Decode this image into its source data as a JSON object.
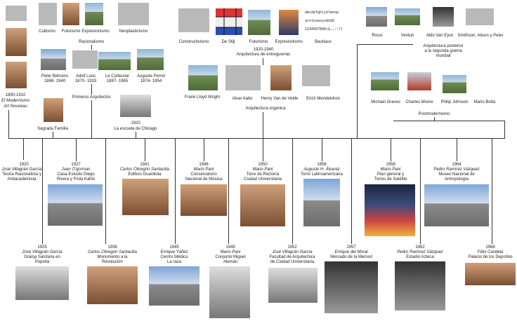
{
  "top_styles": {
    "cubismo": "Cubismo",
    "futurismo": "Futurismo",
    "expresionismo": "Expresionismo",
    "neoplasticismo": "Neoplasticismo",
    "racionalismo": "Racionalismo",
    "modernismo_years": "1890-1910",
    "modernismo_1": "El Modernismo",
    "modernismo_2": "Art Nouveau"
  },
  "architects_row1": {
    "behrens": "Peter Behrens",
    "behrens_years": "1868- 1940",
    "loos": "Adolf Loos",
    "loos_years": "1870- 1933",
    "corbusier": "Le Corbusier",
    "corbusier_years": "1887- 1965",
    "perret": "Auguste Perret",
    "perret_years": "1874- 1954"
  },
  "primeros": {
    "label": "Primeros Arquitectos",
    "sagrada": "Sagrada Familia",
    "chicago_year": "1920",
    "chicago": "La escuela de Chicago"
  },
  "entreguerras": {
    "constructivismo": "Constructivismo",
    "destijl": "De Stijl",
    "futurismo": "Futurismo",
    "expresionismo": "Expresionismo",
    "bauhaus": "Bauhaus",
    "years": "1920-1940",
    "label": "Arquitectura de entreguerras",
    "wright": "Frank Lloyd Wright",
    "aalto": "Alvar Aalto",
    "velde": "Henry Van de Velde",
    "mendelshon": "Erich Mendelshon",
    "organica": "Arquitectura organica",
    "bauhaus_font_1": "abcdefghijklmnop",
    "bauhaus_font_2": "qrstuvwxyzäöüß",
    "bauhaus_font_3": "1234567890(&.,:!?)"
  },
  "posterior": {
    "rossi": "Rossi",
    "venturi": "Venturi",
    "eyck": "Aldo Van Eyck",
    "smithson": "Smithson, Alison y Peter",
    "label_1": "Arquitectura posterior",
    "label_2": "a la segunda guerra",
    "label_3": "mundial",
    "graves": "Michael Graves",
    "moore": "Charles Moore",
    "johnson": "Philip Johnson",
    "botta": "Mario Botta",
    "posmo": "Postmodernismo"
  },
  "timeline_upper": [
    {
      "year": "1920",
      "author": "José Villagrán García",
      "line2": "Teoría Racionalista y",
      "line3": "Antiacademista",
      "line4": ""
    },
    {
      "year": "1927",
      "author": "Juan O'gorman",
      "line2": "Casa-Estudio Diego",
      "line3": "Rivera y Frida Kahlo",
      "line4": ""
    },
    {
      "year": "1941",
      "author": "Carlos Obregón Santacilia",
      "line2": "Edificio Guardiola",
      "line3": "",
      "line4": ""
    },
    {
      "year": "1946",
      "author": "Mario Pani",
      "line2": "Conservatorio",
      "line3": "Nacional de Música",
      "line4": ""
    },
    {
      "year": "1950",
      "author": "Mario Pani",
      "line2": "Torre de Rectoría",
      "line3": "Ciudad Universitaria",
      "line4": ""
    },
    {
      "year": "1956",
      "author": "Augusto H. Álvarez",
      "line2": "Torre Latinoamericana",
      "line3": "",
      "line4": ""
    },
    {
      "year": "1958",
      "author": "Mario Pani",
      "line2": "Plan general y",
      "line3": "Torres de Satélite",
      "line4": ""
    },
    {
      "year": "1964",
      "author": "Pedro Ramírez Vázquez",
      "line2": "Museo Nacional de",
      "line3": "Antropología",
      "line4": ""
    }
  ],
  "timeline_lower": [
    {
      "year": "1925",
      "author": "José Villagrán García",
      "line2": "Granja Sanitaria en",
      "line3": "Popotla"
    },
    {
      "year": "1938",
      "author": "Carlos Obregón Santacilia",
      "line2": "Monumento a la",
      "line3": "Revolución"
    },
    {
      "year": "1945",
      "author": "Enrique Yáñez",
      "line2": "Centro Médico",
      "line3": "La raza"
    },
    {
      "year": "1949",
      "author": "Mario Pani",
      "line2": "Conjunto Miguel",
      "line3": "Alemán"
    },
    {
      "year": "1952",
      "author": "José Villagrán García",
      "line2": "Facultad de Arquitectura",
      "line3": "de Ciudad Universitaria"
    },
    {
      "year": "1957",
      "author": "Enrique del Moral",
      "line2": "Mercado de la Merced",
      "line3": ""
    },
    {
      "year": "1962",
      "author": "Pedro Ramírez Vázquez",
      "line2": "Estadio Azteca",
      "line3": ""
    },
    {
      "year": "1968",
      "author": "Félix Candela",
      "line2": "Palacio de los Deportes",
      "line3": ""
    }
  ]
}
